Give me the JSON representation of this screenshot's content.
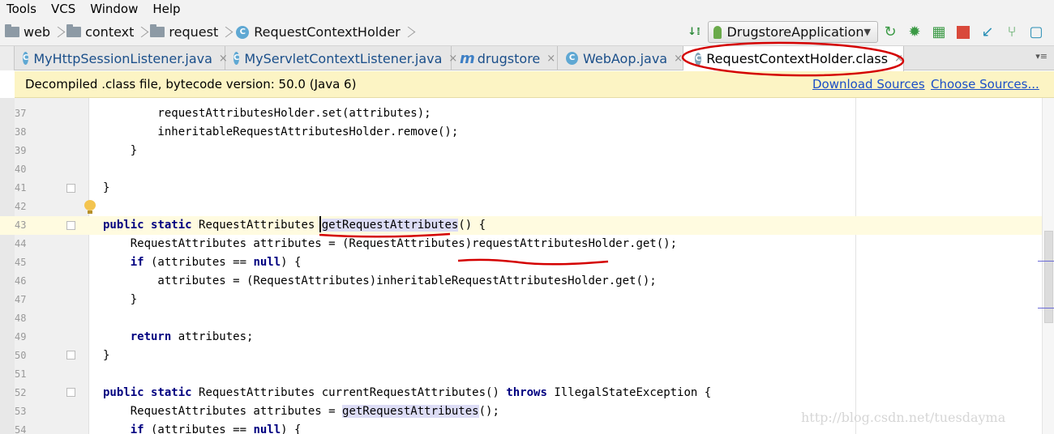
{
  "menu": [
    "Tools",
    "VCS",
    "Window",
    "Help"
  ],
  "breadcrumbs": [
    {
      "label": "web",
      "icon": "folder-icon"
    },
    {
      "label": "context",
      "icon": "folder-icon"
    },
    {
      "label": "request",
      "icon": "folder-icon"
    },
    {
      "label": "RequestContextHolder",
      "icon": "class-icon"
    }
  ],
  "class_icon_letter": "C",
  "run_config": {
    "label": "DrugstoreApplication"
  },
  "tabs": [
    {
      "label": "MyHttpSessionListener.java",
      "icon": "class-icon",
      "active": false
    },
    {
      "label": "MyServletContextListener.java",
      "icon": "class-icon",
      "active": false
    },
    {
      "label": "drugstore",
      "icon": "maven-icon",
      "active": false
    },
    {
      "label": "WebAop.java",
      "icon": "class-icon",
      "active": false
    },
    {
      "label": "RequestContextHolder.class",
      "icon": "class-icon",
      "active": true
    }
  ],
  "maven_letter": "m",
  "tab_close": "×",
  "banner": {
    "message": "Decompiled .class file, bytecode version: 50.0 (Java 6)",
    "download_sources": "Download Sources",
    "choose_sources": "Choose Sources..."
  },
  "code_lines": [
    {
      "num": "37",
      "text": "        requestAttributesHolder.set(attributes);"
    },
    {
      "num": "38",
      "text": "        inheritableRequestAttributesHolder.remove();"
    },
    {
      "num": "39",
      "text": "    }"
    },
    {
      "num": "40",
      "text": ""
    },
    {
      "num": "41",
      "text": "}"
    },
    {
      "num": "42",
      "text": ""
    },
    {
      "num": "43",
      "text": "public static RequestAttributes getRequestAttributes() {"
    },
    {
      "num": "44",
      "text": "    RequestAttributes attributes = (RequestAttributes)requestAttributesHolder.get();"
    },
    {
      "num": "45",
      "text": "    if (attributes == null) {"
    },
    {
      "num": "46",
      "text": "        attributes = (RequestAttributes)inheritableRequestAttributesHolder.get();"
    },
    {
      "num": "47",
      "text": "    }"
    },
    {
      "num": "48",
      "text": ""
    },
    {
      "num": "49",
      "text": "    return attributes;"
    },
    {
      "num": "50",
      "text": "}"
    },
    {
      "num": "51",
      "text": ""
    },
    {
      "num": "52",
      "text": "public static RequestAttributes currentRequestAttributes() throws IllegalStateException {"
    },
    {
      "num": "53",
      "text": "    RequestAttributes attributes = getRequestAttributes();"
    },
    {
      "num": "54",
      "text": "    if (attributes == null) {"
    }
  ],
  "current_line": "43",
  "colors": {
    "keyword": "#000080",
    "annotation": "#d40000",
    "banner_bg": "#fcf4c4",
    "link": "#1a4ec7"
  },
  "watermark": "http://blog.csdn.net/tuesdayma"
}
